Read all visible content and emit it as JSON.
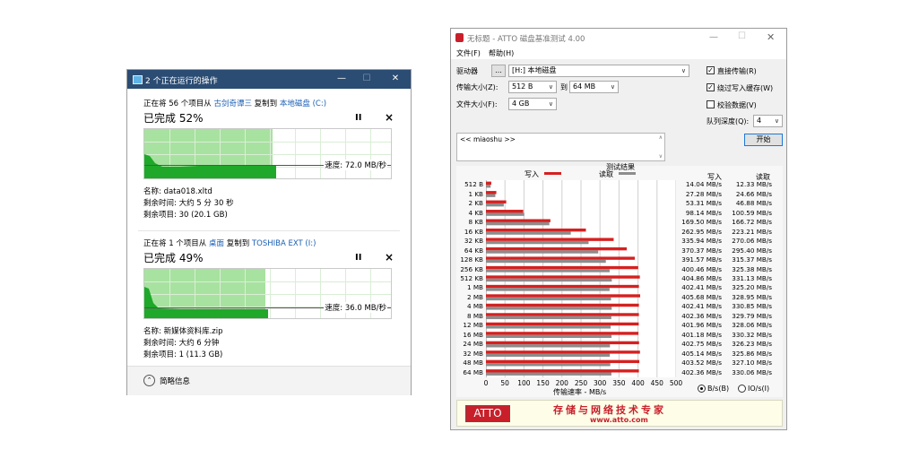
{
  "copy_dialog": {
    "title": "2 个正在运行的操作",
    "ops": [
      {
        "desc_prefix": "正在将 56 个项目从",
        "source": "古剑奇谭三",
        "desc_mid": "复制到",
        "dest": "本地磁盘 (C:)",
        "percent_text": "已完成 52%",
        "progress": 0.52,
        "speed_text": "速度: 72.0 MB/秒",
        "name": "名称: data018.xltd",
        "time_left": "剩余时间: 大约 5 分 30 秒",
        "items_left": "剩余项目: 30 (20.1 GB)"
      },
      {
        "desc_prefix": "正在将 1 个项目从",
        "source": "桌面",
        "desc_mid": "复制到",
        "dest": "TOSHIBA EXT (I:)",
        "percent_text": "已完成 49%",
        "progress": 0.49,
        "speed_text": "速度: 36.0 MB/秒",
        "name": "名称: 新媒体资料库.zip",
        "time_left": "剩余时间: 大约 6 分钟",
        "items_left": "剩余项目: 1 (11.3 GB)"
      }
    ],
    "pause_glyph": "II",
    "close_glyph": "×",
    "less_info": "简略信息"
  },
  "atto": {
    "title": "无标题 - ATTO 磁盘基准测试 4.00",
    "menu": [
      "文件(F)",
      "帮助(H)"
    ],
    "drive_label": "驱动器",
    "drive_browse": "...",
    "drive_value": "[H:] 本地磁盘",
    "transfer_label": "传输大小(Z):",
    "transfer_from": "512 B",
    "transfer_to_label": "到",
    "transfer_to": "64 MB",
    "file_label": "文件大小(F):",
    "file_value": "4 GB",
    "opt_direct": "直接传输(R)",
    "opt_bypass": "绕过写入缓存(W)",
    "opt_verify": "校验数据(V)",
    "queue_label": "队列深度(Q):",
    "queue_value": "4",
    "start_button": "开始",
    "notes": "<< miaoshu >>",
    "results_title": "测试结果",
    "legend_write": "写入",
    "legend_read": "读取",
    "col_write": "写入",
    "col_read": "读取",
    "axis_label": "传输速率 - MB/s",
    "unit_bs": "B/s(B)",
    "unit_io": "IO/s(I)",
    "banner_logo": "ATTO",
    "banner_slogan": "存储与网络技术专家",
    "banner_url": "www.atto.com",
    "colors": {
      "write": "#d62020",
      "read": "#8c8c8c"
    }
  },
  "chart_data": {
    "type": "bar",
    "orientation": "horizontal",
    "title": "测试结果",
    "xlabel": "传输速率 - MB/s",
    "xlim": [
      0,
      500
    ],
    "xticks": [
      0,
      50,
      100,
      150,
      200,
      250,
      300,
      350,
      400,
      450,
      500
    ],
    "categories": [
      "512 B",
      "1 KB",
      "2 KB",
      "4 KB",
      "8 KB",
      "16 KB",
      "32 KB",
      "64 KB",
      "128 KB",
      "256 KB",
      "512 KB",
      "1 MB",
      "2 MB",
      "4 MB",
      "8 MB",
      "12 MB",
      "16 MB",
      "24 MB",
      "32 MB",
      "48 MB",
      "64 MB"
    ],
    "series": [
      {
        "name": "写入",
        "values": [
          14.04,
          27.28,
          53.31,
          98.14,
          169.5,
          262.95,
          335.94,
          370.37,
          391.57,
          400.46,
          404.86,
          402.41,
          405.68,
          402.41,
          402.36,
          401.96,
          401.18,
          402.75,
          405.14,
          403.52,
          402.36
        ],
        "labels": [
          "14.04 MB/s",
          "27.28 MB/s",
          "53.31 MB/s",
          "98.14 MB/s",
          "169.50 MB/s",
          "262.95 MB/s",
          "335.94 MB/s",
          "370.37 MB/s",
          "391.57 MB/s",
          "400.46 MB/s",
          "404.86 MB/s",
          "402.41 MB/s",
          "405.68 MB/s",
          "402.41 MB/s",
          "402.36 MB/s",
          "401.96 MB/s",
          "401.18 MB/s",
          "402.75 MB/s",
          "405.14 MB/s",
          "403.52 MB/s",
          "402.36 MB/s"
        ]
      },
      {
        "name": "读取",
        "values": [
          12.33,
          24.66,
          46.88,
          100.59,
          166.72,
          223.21,
          270.06,
          295.4,
          315.37,
          325.38,
          331.13,
          325.2,
          328.95,
          330.85,
          329.79,
          328.06,
          330.32,
          326.23,
          325.86,
          327.1,
          330.06
        ],
        "labels": [
          "12.33 MB/s",
          "24.66 MB/s",
          "46.88 MB/s",
          "100.59 MB/s",
          "166.72 MB/s",
          "223.21 MB/s",
          "270.06 MB/s",
          "295.40 MB/s",
          "315.37 MB/s",
          "325.38 MB/s",
          "331.13 MB/s",
          "325.20 MB/s",
          "328.95 MB/s",
          "330.85 MB/s",
          "329.79 MB/s",
          "328.06 MB/s",
          "330.32 MB/s",
          "326.23 MB/s",
          "325.86 MB/s",
          "327.10 MB/s",
          "330.06 MB/s"
        ]
      }
    ]
  }
}
